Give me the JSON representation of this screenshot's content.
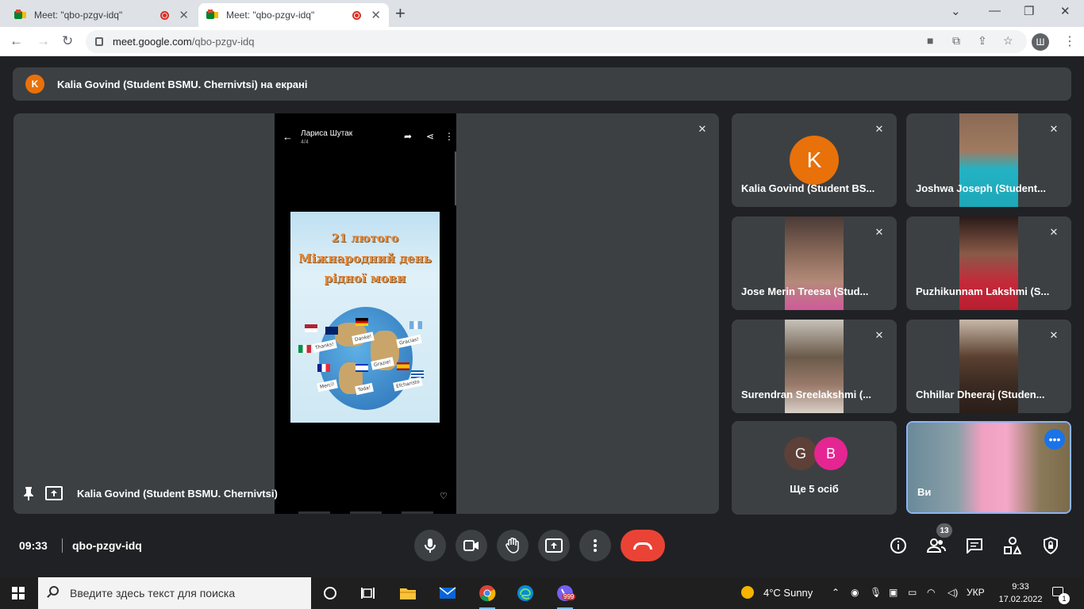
{
  "browser": {
    "tabs": [
      {
        "title": "Meet: \"qbo-pzgv-idq\"",
        "active": false
      },
      {
        "title": "Meet: \"qbo-pzgv-idq\"",
        "active": true
      }
    ],
    "new_tab": "+",
    "url_host": "meet.google.com",
    "url_path": "/qbo-pzgv-idq",
    "profile_initial": "Ш"
  },
  "banner": {
    "avatar_initial": "K",
    "text": "Kalia Govind (Student BSMU. Chernivtsi) на екрані"
  },
  "stage": {
    "presenter": "Kalia Govind (Student BSMU. Chernivtsi)",
    "phone": {
      "name": "Лариса Шутак",
      "count": "4/4",
      "poster_line1": "21 лютого",
      "poster_line2": "Міжнародний день",
      "poster_line3": "рідної мови",
      "notes": [
        "Thanks!",
        "Danke!",
        "Gracias!",
        "Grazie!",
        "Merci!",
        "Toda!",
        "Efcharisto"
      ]
    }
  },
  "participants": [
    {
      "name": "Kalia Govind (Student BS...",
      "avatar": "K",
      "has_video": false
    },
    {
      "name": "Joshwa Joseph (Student...",
      "has_video": true
    },
    {
      "name": "Jose Merin Treesa (Stud...",
      "has_video": true
    },
    {
      "name": "Puzhikunnam Lakshmi (S...",
      "has_video": true
    },
    {
      "name": "Surendran Sreelakshmi (...",
      "has_video": true
    },
    {
      "name": "Chhillar Dheeraj (Studen...",
      "has_video": true
    }
  ],
  "more": {
    "avatars": [
      "G",
      "B"
    ],
    "label": "Ще 5 осіб"
  },
  "self": {
    "label": "Ви"
  },
  "bottom": {
    "time": "09:33",
    "meeting_code": "qbo-pzgv-idq",
    "people_count": "13"
  },
  "taskbar": {
    "search_placeholder": "Введите здесь текст для поиска",
    "weather": "4°C  Sunny",
    "lang": "УКР",
    "time": "9:33",
    "date": "17.02.2022",
    "notifications": "1",
    "viber_badge": "999"
  },
  "colors": {
    "meet_bg": "#202124",
    "tile_bg": "#3c4043",
    "accent_orange": "#e8710a",
    "end_red": "#ea4335",
    "self_border": "#8ab4f8"
  }
}
